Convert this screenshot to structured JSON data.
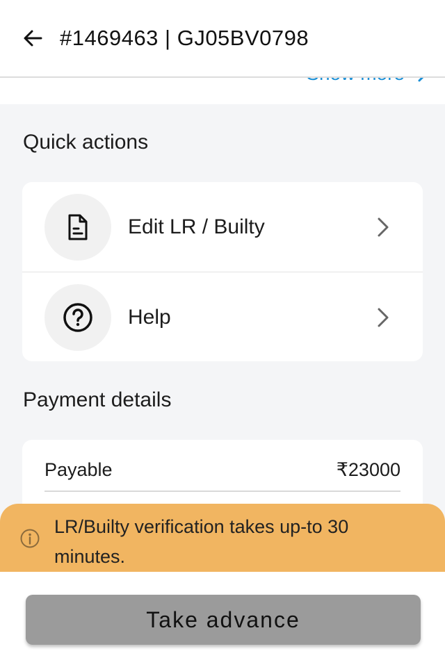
{
  "header": {
    "title": "#1469463 | GJ05BV0798"
  },
  "trip_details": {
    "show_more_label": "Show more"
  },
  "quick_actions": {
    "title": "Quick actions",
    "items": [
      {
        "label": "Edit LR / Builty",
        "icon": "document-icon"
      },
      {
        "label": "Help",
        "icon": "help-circle-icon"
      }
    ]
  },
  "payment_details": {
    "title": "Payment details",
    "rows": [
      {
        "label": "Payable",
        "value": "₹23000"
      }
    ]
  },
  "notice": {
    "message": "LR/Builty verification takes up-to 30 minutes.",
    "color": "#f1b561"
  },
  "footer": {
    "cta_label": "Take advance",
    "cta_color": "#9b9b9b"
  },
  "colors": {
    "link": "#1a8fd6",
    "background": "#f4f5f7"
  }
}
